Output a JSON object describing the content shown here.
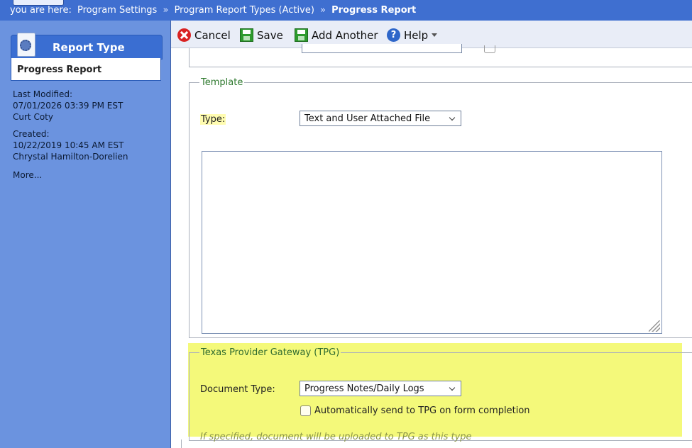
{
  "breadcrumb": {
    "prefix": "you are here:",
    "items": [
      "Program Settings",
      "Program Report Types (Active)"
    ],
    "current": "Progress Report",
    "separator": "»"
  },
  "sidebar": {
    "card_title": "Report Type",
    "card_value": "Progress Report",
    "last_modified_label": "Last Modified:",
    "last_modified_date": "07/01/2026 03:39 PM EST",
    "last_modified_by": "Curt Coty",
    "created_label": "Created:",
    "created_date": "10/22/2019 10:45 AM EST",
    "created_by": "Chrystal Hamilton-Dorelien",
    "more_link": "More..."
  },
  "toolbar": {
    "cancel_label": "Cancel",
    "save_label": "Save",
    "add_another_label": "Add Another",
    "help_label": "Help"
  },
  "template": {
    "legend": "Template",
    "type_label": "Type:",
    "type_value": "Text and User Attached File",
    "text_value": ""
  },
  "tpg": {
    "legend": "Texas Provider Gateway (TPG)",
    "document_type_label": "Document Type:",
    "document_type_value": "Progress Notes/Daily Logs",
    "auto_send_label": "Automatically send to TPG on form completion",
    "auto_send_checked": false,
    "hint": "If specified, document will be uploaded to TPG as this type"
  },
  "colors": {
    "topbar": "#3f6fd0",
    "sidebar": "#6b93df",
    "legend_green": "#2f7a2f",
    "highlight": "#f4f97a"
  }
}
